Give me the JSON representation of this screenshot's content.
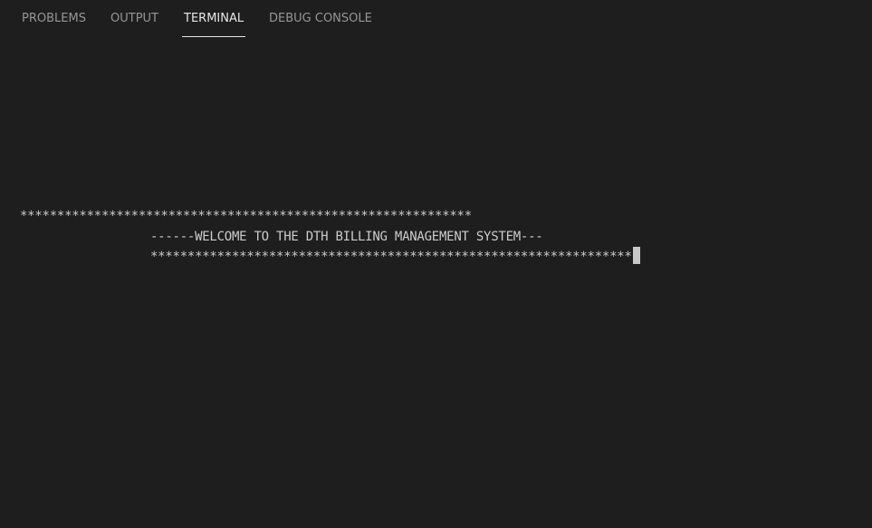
{
  "panel": {
    "tabs": [
      {
        "label": "PROBLEMS",
        "active": false
      },
      {
        "label": "OUTPUT",
        "active": false
      },
      {
        "label": "TERMINAL",
        "active": true
      },
      {
        "label": "DEBUG CONSOLE",
        "active": false
      }
    ]
  },
  "terminal": {
    "lines": [
      "*************************************************************",
      "------WELCOME TO THE DTH BILLING MANAGEMENT SYSTEM---",
      "*****************************************************************"
    ],
    "cursor": "block-cursor"
  },
  "colors": {
    "background": "#1e1e1e",
    "tab_inactive": "#969696",
    "tab_active": "#e7e7e7",
    "terminal_text": "#cccccc"
  }
}
